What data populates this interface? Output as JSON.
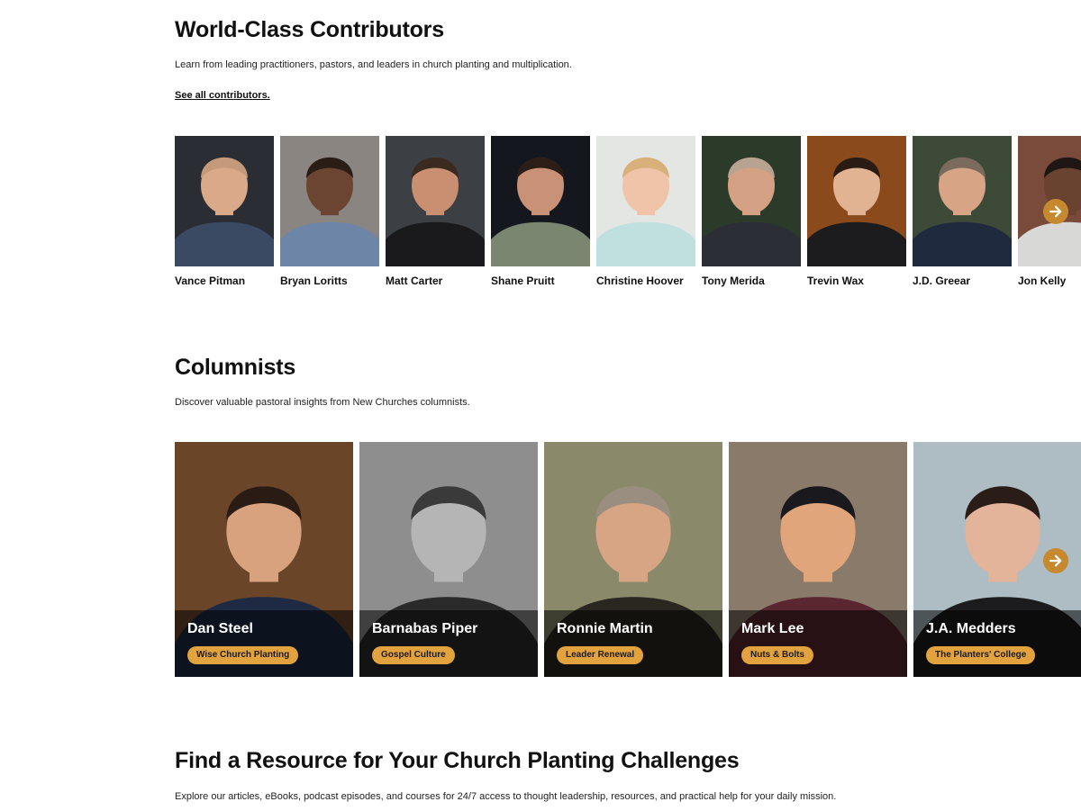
{
  "contributors_section": {
    "title": "World-Class Contributors",
    "subtitle": "Learn from leading practitioners, pastors, and leaders in church planting and multiplication.",
    "link": "See all contributors.",
    "next_icon": "arrow-right-icon",
    "people": [
      {
        "name": "Vance Pitman",
        "bg": "#2a2d33",
        "shirt": "#3a4a63",
        "skin": "#d9a989",
        "hair": "#c49a7a"
      },
      {
        "name": "Bryan Loritts",
        "bg": "#8a8580",
        "shirt": "#6d86a8",
        "skin": "#6b4532",
        "hair": "#2a1d16"
      },
      {
        "name": "Matt Carter",
        "bg": "#3c3f44",
        "shirt": "#1a1a1c",
        "skin": "#c88f70",
        "hair": "#3b2a20"
      },
      {
        "name": "Shane Pruitt",
        "bg": "#14181e",
        "shirt": "#7b8670",
        "skin": "#c99176",
        "hair": "#2c1e16"
      },
      {
        "name": "Christine Hoover",
        "bg": "#e4e6e4",
        "shirt": "#bfe0df",
        "skin": "#efc4a8",
        "hair": "#d7b07a"
      },
      {
        "name": "Tony Merida",
        "bg": "#2c3a2a",
        "shirt": "#2b2e35",
        "skin": "#d4a184",
        "hair": "#b8a290"
      },
      {
        "name": "Trevin Wax",
        "bg": "#8a4a1c",
        "shirt": "#1c1c1e",
        "skin": "#e2b392",
        "hair": "#2a1c14"
      },
      {
        "name": "J.D. Greear",
        "bg": "#3d4a38",
        "shirt": "#1f2a3e",
        "skin": "#d7a486",
        "hair": "#7b6a5e"
      },
      {
        "name": "Jon Kelly",
        "bg": "#7a4a3a",
        "shirt": "#d8d8d6",
        "skin": "#6a4330",
        "hair": "#1e1612"
      }
    ]
  },
  "columnists_section": {
    "title": "Columnists",
    "subtitle": "Discover valuable pastoral insights from New Churches columnists.",
    "next_icon": "arrow-right-icon",
    "people": [
      {
        "name": "Dan Steel",
        "tag": "Wise Church Planting",
        "bg": "#6a4528",
        "shirt": "#1e2a44",
        "skin": "#d9a27e",
        "hair": "#2a1c14"
      },
      {
        "name": "Barnabas Piper",
        "tag": "Gospel Culture",
        "bg": "#8e8e8e",
        "shirt": "#2a2a2a",
        "skin": "#b5b5b5",
        "hair": "#3a3a3a"
      },
      {
        "name": "Ronnie Martin",
        "tag": "Leader Renewal",
        "bg": "#8a8a6a",
        "shirt": "#2a2620",
        "skin": "#d7a484",
        "hair": "#9a8e80"
      },
      {
        "name": "Mark Lee",
        "tag": "Nuts & Bolts",
        "bg": "#8a7a6a",
        "shirt": "#5a2630",
        "skin": "#e0a57a",
        "hair": "#1a1a1e"
      },
      {
        "name": "J.A. Medders",
        "tag": "The Planters' College",
        "bg": "#aebcc4",
        "shirt": "#1c1c1e",
        "skin": "#e3b49a",
        "hair": "#2a1c16"
      }
    ]
  },
  "resource_section": {
    "title": "Find a Resource for Your Church Planting Challenges",
    "subtitle": "Explore our articles, eBooks, podcast episodes, and courses for 24/7 access to thought leadership, resources, and practical help for your daily mission."
  },
  "colors": {
    "accent": "#c7892f",
    "tag": "#e2a23e"
  }
}
